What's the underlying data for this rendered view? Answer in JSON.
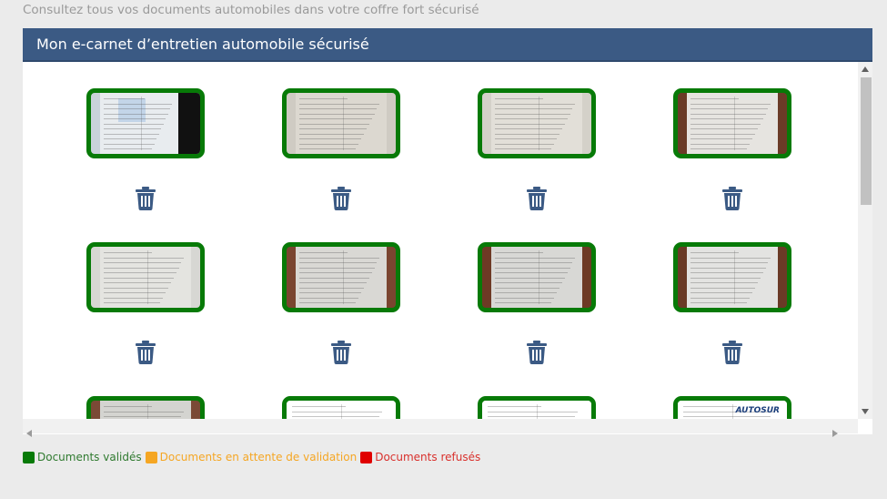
{
  "page": {
    "subtitle": "Consultez tous vos documents automobiles dans votre coffre fort sécurisé"
  },
  "panel": {
    "title": "Mon e-carnet d’entretien automobile sécurisé"
  },
  "documents": [
    {
      "row": 0,
      "col": 0,
      "status": "validated",
      "bg": "#c9d3da",
      "page": "#e8ecef",
      "dark_right": true
    },
    {
      "row": 0,
      "col": 1,
      "status": "validated",
      "bg": "#cfcbc3",
      "page": "#dcd8d0"
    },
    {
      "row": 0,
      "col": 2,
      "status": "validated",
      "bg": "#d4d1c9",
      "page": "#e2dfd8"
    },
    {
      "row": 0,
      "col": 3,
      "status": "validated",
      "bg": "#6a3b27",
      "page": "#e6e4e0"
    },
    {
      "row": 1,
      "col": 0,
      "status": "validated",
      "bg": "#d7d7d3",
      "page": "#e4e4e0"
    },
    {
      "row": 1,
      "col": 1,
      "status": "validated",
      "bg": "#7a4530",
      "page": "#d9d8d4"
    },
    {
      "row": 1,
      "col": 2,
      "status": "validated",
      "bg": "#6d3a25",
      "page": "#d8d8d5"
    },
    {
      "row": 1,
      "col": 3,
      "status": "validated",
      "bg": "#6a3a26",
      "page": "#e3e3e1"
    },
    {
      "row": 2,
      "col": 0,
      "status": "validated",
      "bg": "#7a4a36",
      "page": "#d4d4d0"
    },
    {
      "row": 2,
      "col": 1,
      "status": "validated",
      "bg": "#ffffff",
      "page": "#ffffff"
    },
    {
      "row": 2,
      "col": 2,
      "status": "validated",
      "bg": "#ffffff",
      "page": "#ffffff"
    },
    {
      "row": 2,
      "col": 3,
      "status": "validated",
      "bg": "#ffffff",
      "page": "#ffffff",
      "brand": "AUTOSUR"
    }
  ],
  "icons": {
    "delete": "trash-icon",
    "scroll_up": "arrow-up-icon",
    "scroll_down": "arrow-down-icon",
    "scroll_left": "arrow-left-icon",
    "scroll_right": "arrow-right-icon"
  },
  "legend": [
    {
      "label": "Documents validés",
      "color": "#077a07",
      "text_color": "#2f7a2f"
    },
    {
      "label": "Documents en attente de validation",
      "color": "#f5a623",
      "text_color": "#f5a623"
    },
    {
      "label": "Documents refusés",
      "color": "#e00000",
      "text_color": "#d9302c"
    }
  ],
  "colors": {
    "header": "#3b5a84",
    "validated_border": "#077a07",
    "trash": "#3b5a84"
  }
}
